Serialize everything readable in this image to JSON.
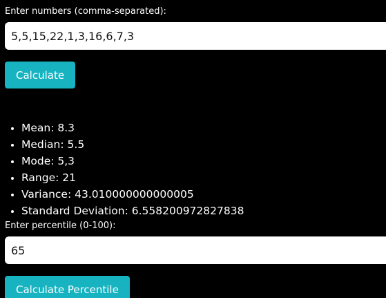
{
  "numbers": {
    "label": "Enter numbers (comma-separated):",
    "value": "5,5,15,22,1,3,16,6,7,3"
  },
  "calculate_button": "Calculate",
  "results": [
    "Mean: 8.3",
    "Median: 5.5",
    "Mode: 5,3",
    "Range: 21",
    "Variance: 43.010000000000005",
    "Standard Deviation: 6.558200972827838"
  ],
  "percentile": {
    "label": "Enter percentile (0-100):",
    "value": "65"
  },
  "percentile_button": "Calculate Percentile",
  "colors": {
    "background": "#000000",
    "button": "#17b3c1",
    "input_bg": "#ffffff"
  }
}
